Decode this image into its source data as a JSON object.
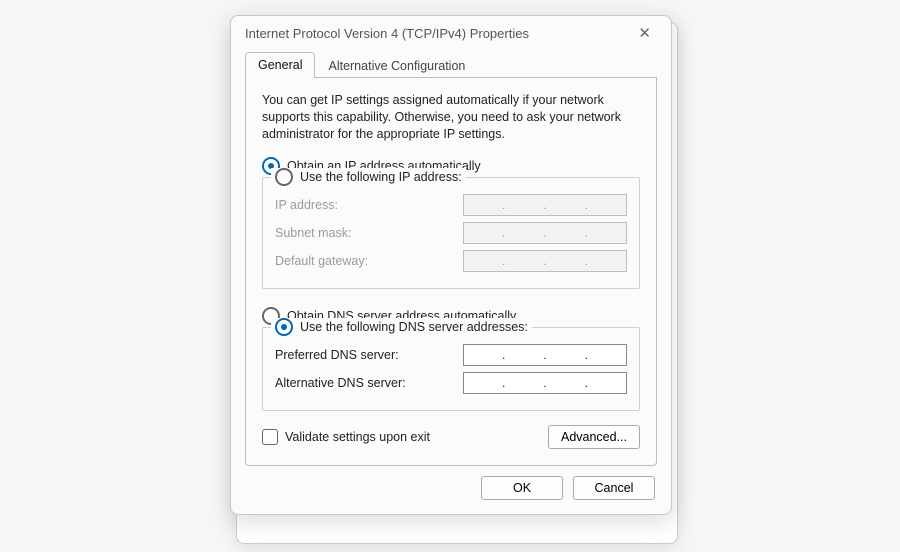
{
  "window": {
    "title": "Internet Protocol Version 4 (TCP/IPv4) Properties"
  },
  "tabs": {
    "general": "General",
    "alternative": "Alternative Configuration",
    "active": "general"
  },
  "description": "You can get IP settings assigned automatically if your network supports this capability. Otherwise, you need to ask your network administrator for the appropriate IP settings.",
  "ip": {
    "auto_label": "Obtain an IP address automatically",
    "manual_label": "Use the following IP address:",
    "selected": "auto",
    "fields": {
      "ip_address_label": "IP address:",
      "subnet_mask_label": "Subnet mask:",
      "default_gateway_label": "Default gateway:",
      "ip_address": [
        "",
        "",
        "",
        ""
      ],
      "subnet_mask": [
        "",
        "",
        "",
        ""
      ],
      "default_gateway": [
        "",
        "",
        "",
        ""
      ]
    }
  },
  "dns": {
    "auto_label": "Obtain DNS server address automatically",
    "manual_label": "Use the following DNS server addresses:",
    "selected": "manual",
    "fields": {
      "preferred_label": "Preferred DNS server:",
      "alternative_label": "Alternative DNS server:",
      "preferred": [
        "",
        "",
        "",
        ""
      ],
      "alternative": [
        "",
        "",
        "",
        ""
      ]
    }
  },
  "validate": {
    "label": "Validate settings upon exit",
    "checked": false
  },
  "buttons": {
    "advanced": "Advanced...",
    "ok": "OK",
    "cancel": "Cancel"
  }
}
